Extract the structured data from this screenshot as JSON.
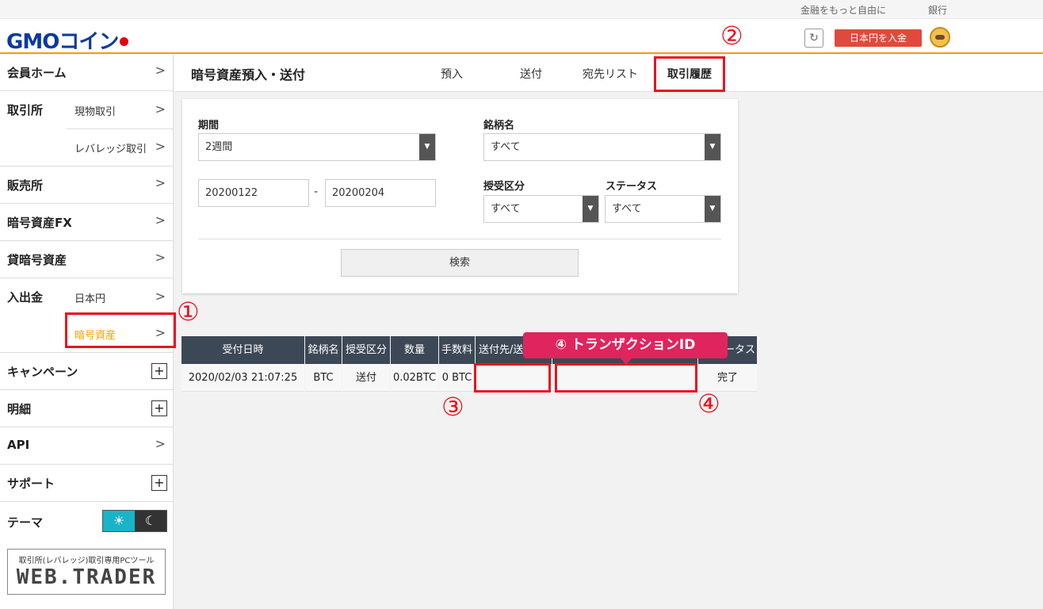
{
  "topbar": {
    "links": [
      "金融をもっと自由に",
      "銀行"
    ]
  },
  "header": {
    "logo": "GMOコイン",
    "deposit_button": "日本円を入金"
  },
  "sidebar": {
    "member_home": "会員ホーム",
    "exchange": {
      "title": "取引所",
      "items": [
        "現物取引",
        "レバレッジ取引"
      ]
    },
    "sales": "販売所",
    "fx": "暗号資産FX",
    "lending": "貸暗号資産",
    "deposit": {
      "title": "入出金",
      "items": [
        "日本円",
        "暗号資産"
      ]
    },
    "campaign": "キャンペーン",
    "statement": "明細",
    "api": "API",
    "support": "サポート",
    "theme": "テーマ",
    "webtrader": {
      "caption": "取引所(レバレッジ)取引専用PCツール",
      "logo": "WEB.TRADER"
    }
  },
  "main": {
    "title": "暗号資産預入・送付",
    "tabs": [
      "預入",
      "送付",
      "宛先リスト",
      "取引履歴"
    ],
    "active_tab": "取引履歴"
  },
  "filter": {
    "period_label": "期間",
    "period_value": "2週間",
    "brand_label": "銘柄名",
    "brand_value": "すべて",
    "date_from": "20200122",
    "date_sep": "-",
    "date_to": "20200204",
    "type_label": "授受区分",
    "type_value": "すべて",
    "status_label": "ステータス",
    "status_value": "すべて",
    "search_button": "検索"
  },
  "table": {
    "headers": [
      "受付日時",
      "銘柄名",
      "授受区分",
      "数量",
      "手数料",
      "送付先/送",
      "トランザクションID",
      "ステータス"
    ],
    "visible_headers": [
      "受付日時",
      "銘柄名",
      "授受区分",
      "数量",
      "手数料",
      "送付先/送",
      "ータス"
    ],
    "row": [
      "2020/02/03 21:07:25",
      "BTC",
      "送付",
      "0.02BTC",
      "0 BTC",
      "",
      "",
      "完了"
    ]
  },
  "annotations": {
    "marks": [
      "①",
      "②",
      "③",
      "④"
    ],
    "callout": "④ トランザクションID",
    "highlight_color": "#e8141f",
    "callout_color": "#e0245e"
  }
}
